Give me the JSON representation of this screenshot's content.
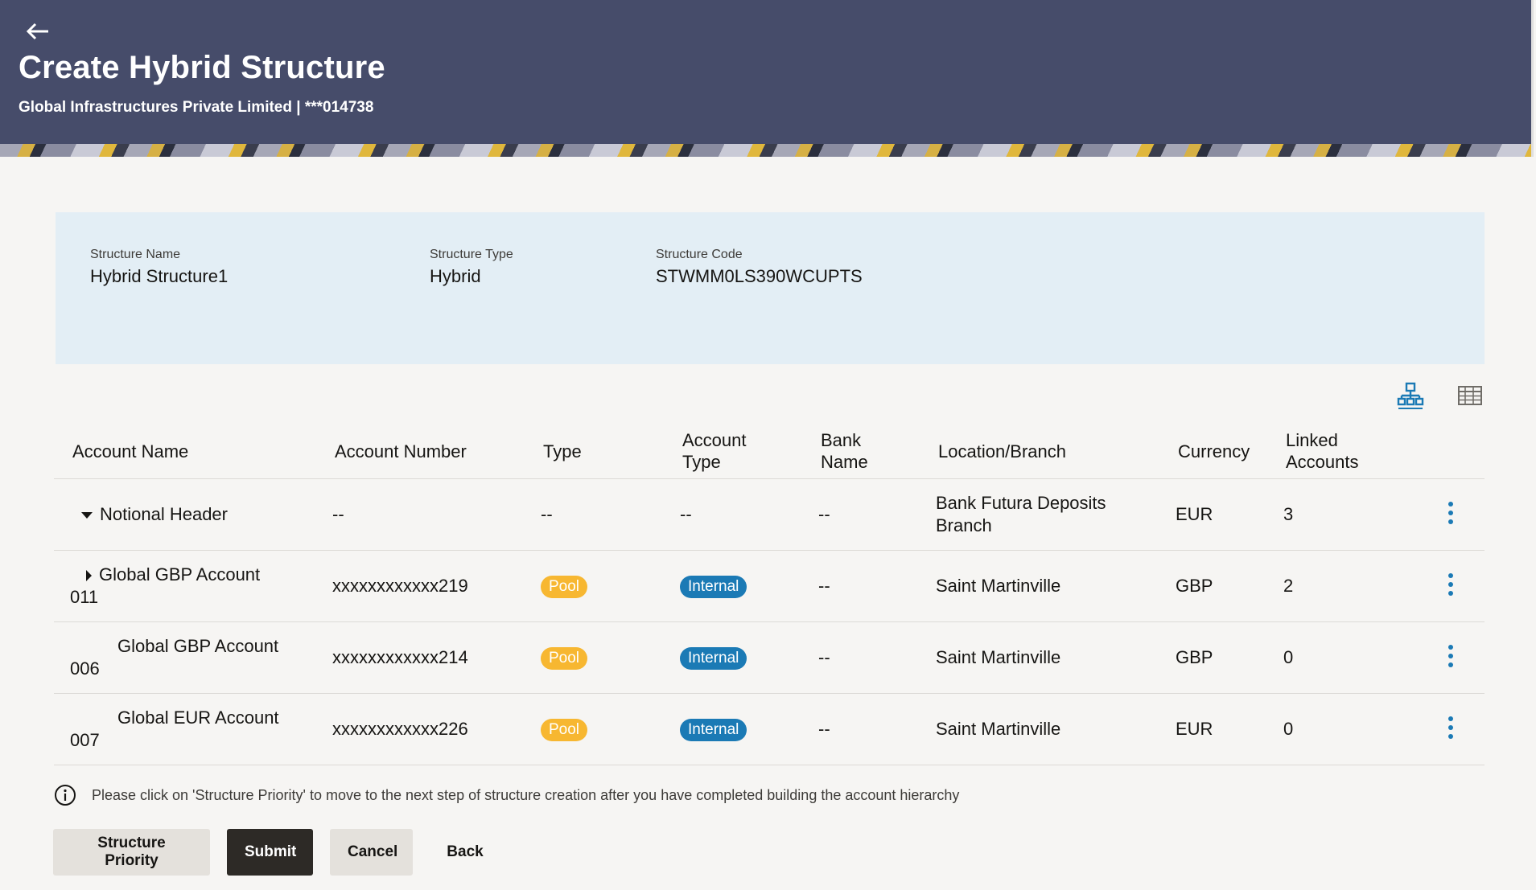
{
  "header": {
    "title": "Create Hybrid Structure",
    "subtitle": "Global Infrastructures Private Limited | ***014738"
  },
  "structure": {
    "name_label": "Structure Name",
    "name_value": "Hybrid Structure1",
    "type_label": "Structure Type",
    "type_value": "Hybrid",
    "code_label": "Structure Code",
    "code_value": "STWMM0LS390WCUPTS"
  },
  "view_toggles": {
    "hierarchy_icon": "hierarchy-icon",
    "table_icon": "table-grid-icon"
  },
  "table": {
    "columns": {
      "account_name": "Account Name",
      "account_number": "Account Number",
      "type": "Type",
      "account_type_1": "Account",
      "account_type_2": "Type",
      "bank_name_1": "Bank",
      "bank_name_2": "Name",
      "location": "Location/Branch",
      "currency": "Currency",
      "linked_1": "Linked",
      "linked_2": "Accounts"
    },
    "rows": [
      {
        "name_1": "Notional Header",
        "name_2": "",
        "account_number": "--",
        "type": "--",
        "account_type": "--",
        "bank_name": "--",
        "location_1": "Bank Futura Deposits",
        "location_2": "Branch",
        "currency": "EUR",
        "linked": "3"
      },
      {
        "name_1": "Global GBP Account",
        "name_2": "011",
        "account_number": "xxxxxxxxxxxx219",
        "type": "Pool",
        "account_type": "Internal",
        "bank_name": "--",
        "location_1": "Saint Martinville",
        "currency": "GBP",
        "linked": "2"
      },
      {
        "name_1": "Global GBP Account",
        "name_2": "006",
        "account_number": "xxxxxxxxxxxx214",
        "type": "Pool",
        "account_type": "Internal",
        "bank_name": "--",
        "location_1": "Saint Martinville",
        "currency": "GBP",
        "linked": "0"
      },
      {
        "name_1": "Global EUR Account",
        "name_2": "007",
        "account_number": "xxxxxxxxxxxx226",
        "type": "Pool",
        "account_type": "Internal",
        "bank_name": "--",
        "location_1": "Saint Martinville",
        "currency": "EUR",
        "linked": "0"
      }
    ]
  },
  "info_message": "Please click on 'Structure Priority' to move to the next step of structure creation after you have completed building the account hierarchy",
  "buttons": {
    "structure_priority": "Structure Priority",
    "submit": "Submit",
    "cancel": "Cancel",
    "back": "Back"
  },
  "colors": {
    "header_bg": "#464c6a",
    "info_card_bg": "#e3eef5",
    "pool_pill": "#f7b731",
    "internal_pill": "#1b7ab5",
    "primary_button": "#2d2a26",
    "kebab": "#1b7ab5"
  }
}
